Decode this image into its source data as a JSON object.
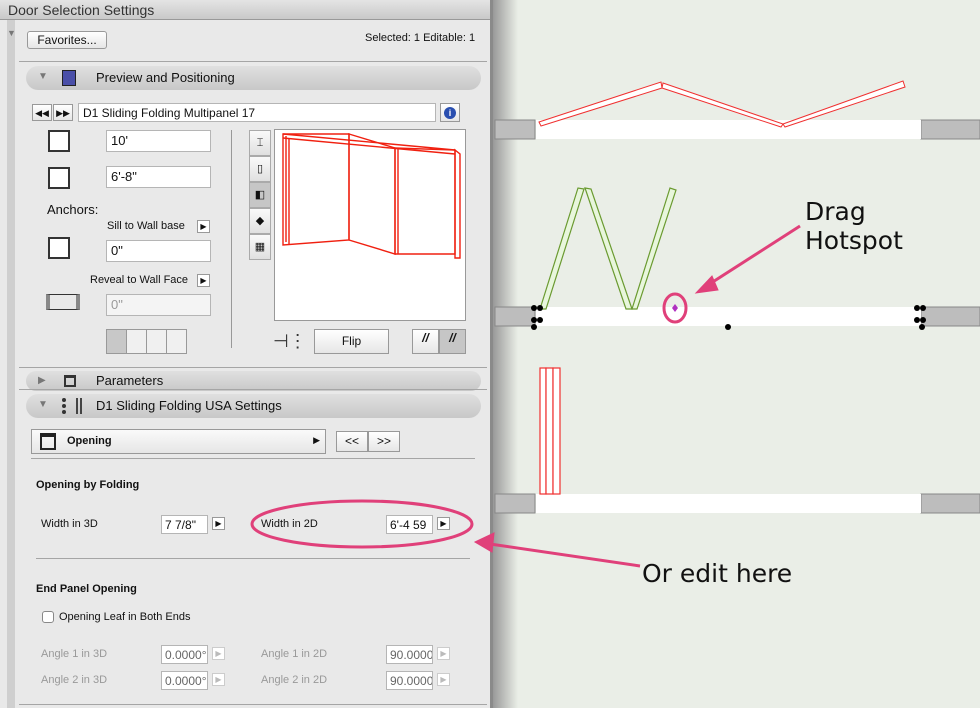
{
  "window": {
    "title": "Door Selection Settings"
  },
  "header": {
    "favorites_label": "Favorites...",
    "selection_status": "Selected: 1 Editable: 1"
  },
  "preview_section": {
    "title": "Preview and Positioning",
    "object_name": "D1 Sliding Folding Multipanel 17",
    "width": "10'",
    "height": "6'-8\"",
    "anchors_label": "Anchors:",
    "sill_anchor_label": "Sill to Wall base",
    "sill_value": "0\"",
    "reveal_anchor_label": "Reveal to Wall Face",
    "reveal_value": "0\"",
    "flip_label": "Flip"
  },
  "parameters_section": {
    "title": "Parameters"
  },
  "settings_section": {
    "title": "D1 Sliding Folding USA Settings",
    "page_select": "Opening",
    "prev_label": "<<",
    "next_label": ">>",
    "opening_group": "Opening by Folding",
    "width_3d_label": "Width in 3D",
    "width_3d_value": "7 7/8\"",
    "width_2d_label": "Width in 2D",
    "width_2d_value": "6'-4 59",
    "end_panel_group": "End Panel Opening",
    "both_ends_label": "Opening Leaf in Both Ends",
    "both_ends_checked": false,
    "angle1_3d_label": "Angle 1 in 3D",
    "angle1_3d_value": "0.0000°",
    "angle2_3d_label": "Angle 2 in 3D",
    "angle2_3d_value": "0.0000°",
    "angle1_2d_label": "Angle 1 in 2D",
    "angle1_2d_value": "90.0000",
    "angle2_2d_label": "Angle 2 in 2D",
    "angle2_2d_value": "90.0000"
  },
  "annotations": {
    "drag_line1": "Drag",
    "drag_line2": "Hotspot",
    "edit_label": "Or edit here",
    "accent": "#e0407a"
  }
}
